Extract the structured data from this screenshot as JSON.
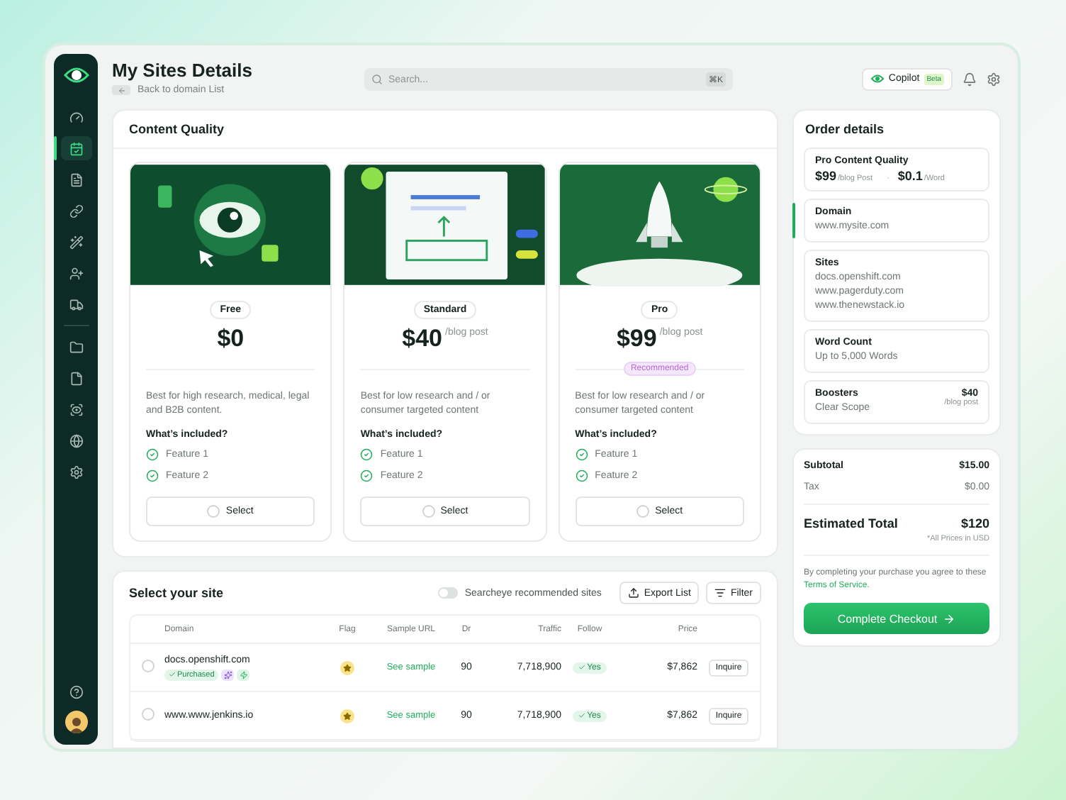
{
  "header": {
    "title": "My Sites Details",
    "back_label": "Back to domain List",
    "search_placeholder": "Search...",
    "shortcut": "⌘K",
    "copilot": "Copilot",
    "copilot_badge": "Beta"
  },
  "sidebar": {
    "groups": [
      [
        {
          "selected": false
        },
        {
          "selected": true
        },
        {
          "selected": false
        },
        {
          "selected": false
        },
        {
          "selected": false
        },
        {
          "selected": false
        },
        {
          "selected": false
        }
      ],
      [
        {
          "selected": false
        },
        {
          "selected": false
        },
        {
          "selected": false
        },
        {
          "selected": false
        },
        {
          "selected": false
        }
      ]
    ]
  },
  "content_quality": {
    "title": "Content Quality",
    "plans": [
      {
        "kind": "eye",
        "name": "Free",
        "price": "$0",
        "description": "Best for high research, medical, legal and B2B content.",
        "included_title": "What’s included?",
        "features": [
          "Feature 1",
          "Feature 2"
        ],
        "select_label": "Select",
        "selected": false
      },
      {
        "kind": "document",
        "name": "Standard",
        "price": "$40",
        "unit": "/blog post",
        "description": "Best for low research and / or consumer targeted content",
        "included_title": "What’s included?",
        "features": [
          "Feature 1",
          "Feature 2"
        ],
        "select_label": "Select",
        "selected": false
      },
      {
        "kind": "rocket",
        "name": "Pro",
        "price": "$99",
        "unit": "/blog post",
        "badge": "Recommended",
        "description": "Best for low research and / or consumer targeted content",
        "included_title": "What’s included?",
        "features": [
          "Feature 1",
          "Feature 2"
        ],
        "select_label": "Select",
        "selected": false
      }
    ]
  },
  "sites": {
    "title": "Select your site",
    "toggle": {
      "label": "Searcheye recommended sites",
      "on": false
    },
    "export_label": "Export List",
    "filter_label": "Filter",
    "columns": [
      "Domain",
      "Flag",
      "Sample URL",
      "Dr",
      "Traffic",
      "Follow",
      "Price"
    ],
    "rows": [
      {
        "selected": false,
        "domain": "docs.openshift.com",
        "status": "Purchased",
        "extras": [
          {
            "kind": "sparkle"
          },
          {
            "kind": "bolt"
          }
        ],
        "flagged": true,
        "sample": "See sample",
        "dr": "90",
        "traffic": "7,718,900",
        "follow": "Yes",
        "price": "$7,862",
        "action": "Inquire"
      },
      {
        "selected": false,
        "domain": "www.www.jenkins.io",
        "flagged": true,
        "sample": "See sample",
        "dr": "90",
        "traffic": "7,718,900",
        "follow": "Yes",
        "price": "$7,862",
        "action": "Inquire"
      }
    ]
  },
  "order": {
    "title": "Order details",
    "items": [
      {
        "kind": "plan",
        "selected": false,
        "title": "Pro Content Quality",
        "price": "$99",
        "price_unit": "/blog Post",
        "separator": "·",
        "rate": "$0.1",
        "rate_unit": "/Word"
      },
      {
        "kind": "field",
        "selected": true,
        "label": "Domain",
        "lines": [
          "www.mysite.com"
        ]
      },
      {
        "kind": "field",
        "selected": false,
        "label": "Sites",
        "lines": [
          "docs.openshift.com",
          "www.pagerduty.com",
          "www.thenewstack.io"
        ]
      },
      {
        "kind": "field",
        "selected": false,
        "label": "Word Count",
        "lines": [
          "Up to 5,000 Words"
        ]
      },
      {
        "kind": "priced",
        "selected": false,
        "label": "Boosters",
        "lines": [
          "Clear Scope"
        ],
        "price": "$40",
        "price_unit": "/blog post"
      }
    ]
  },
  "summary": {
    "subtotal_label": "Subtotal",
    "subtotal": "$15.00",
    "tax_label": "Tax",
    "tax": "$0.00",
    "total_label": "Estimated Total",
    "total": "$120",
    "total_note": "*All Prices in USD",
    "terms_before": "By completing your purchase you agree to these ",
    "terms_link": "Terms of Service",
    "terms_after": ".",
    "checkout_label": "Complete Checkout"
  }
}
